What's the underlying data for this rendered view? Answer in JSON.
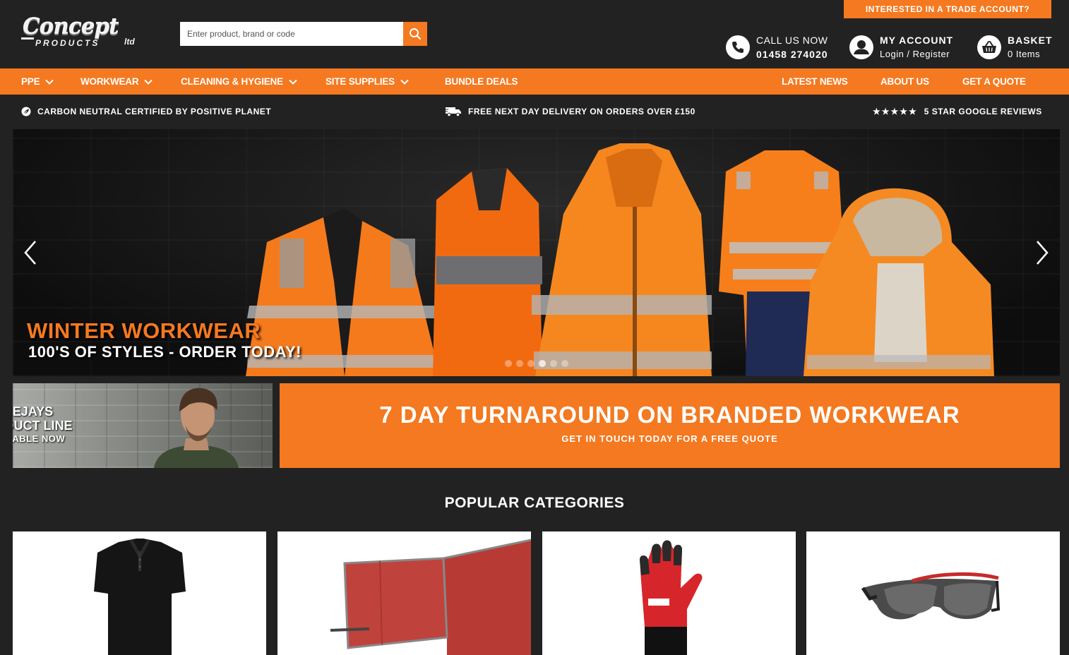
{
  "logo": {
    "line1": "Concept",
    "line2": "PRODUCTS",
    "line3": "ltd"
  },
  "search": {
    "placeholder": "Enter product, brand or code",
    "button_icon": "search-icon"
  },
  "trade_banner": "INTERESTED IN A TRADE ACCOUNT?",
  "header": {
    "call": {
      "label": "CALL US NOW",
      "number": "01458 274020",
      "icon": "phone-icon"
    },
    "account": {
      "label": "MY ACCOUNT",
      "sub": "Login / Register",
      "icon": "user-icon"
    },
    "basket": {
      "label": "BASKET",
      "sub": "0 Items",
      "icon": "basket-icon"
    }
  },
  "nav": {
    "left": [
      {
        "label": "PPE",
        "dropdown": true
      },
      {
        "label": "WORKWEAR",
        "dropdown": true
      },
      {
        "label": "CLEANING & HYGIENE",
        "dropdown": true
      },
      {
        "label": "SITE SUPPLIES",
        "dropdown": true
      },
      {
        "label": "BUNDLE DEALS",
        "dropdown": false
      }
    ],
    "right": [
      {
        "label": "LATEST NEWS"
      },
      {
        "label": "ABOUT US"
      },
      {
        "label": "GET A QUOTE"
      }
    ]
  },
  "usp": {
    "carbon": "CARBON NEUTRAL CERTIFIED BY POSITIVE PLANET",
    "delivery": "FREE NEXT DAY DELIVERY ON ORDERS OVER £150",
    "reviews": "5 STAR GOOGLE REVIEWS",
    "stars": 5
  },
  "hero": {
    "title": "WINTER WORKWEAR",
    "subtitle": "100'S OF STYLES - ORDER TODAY!",
    "slide_count": 6,
    "active_slide": 4
  },
  "promo": {
    "teejays": {
      "line1": "TEEJAYS",
      "line2": "PRODUCT LINE",
      "line3": "AVAILABLE NOW"
    },
    "turnaround": {
      "title": "7 DAY TURNAROUND ON BRANDED WORKWEAR",
      "subtitle": "GET IN TOUCH TODAY FOR A FREE QUOTE"
    }
  },
  "popular": {
    "title": "POPULAR CATEGORIES"
  },
  "colors": {
    "accent": "#f47920",
    "background": "#222222",
    "text": "#ffffff"
  }
}
